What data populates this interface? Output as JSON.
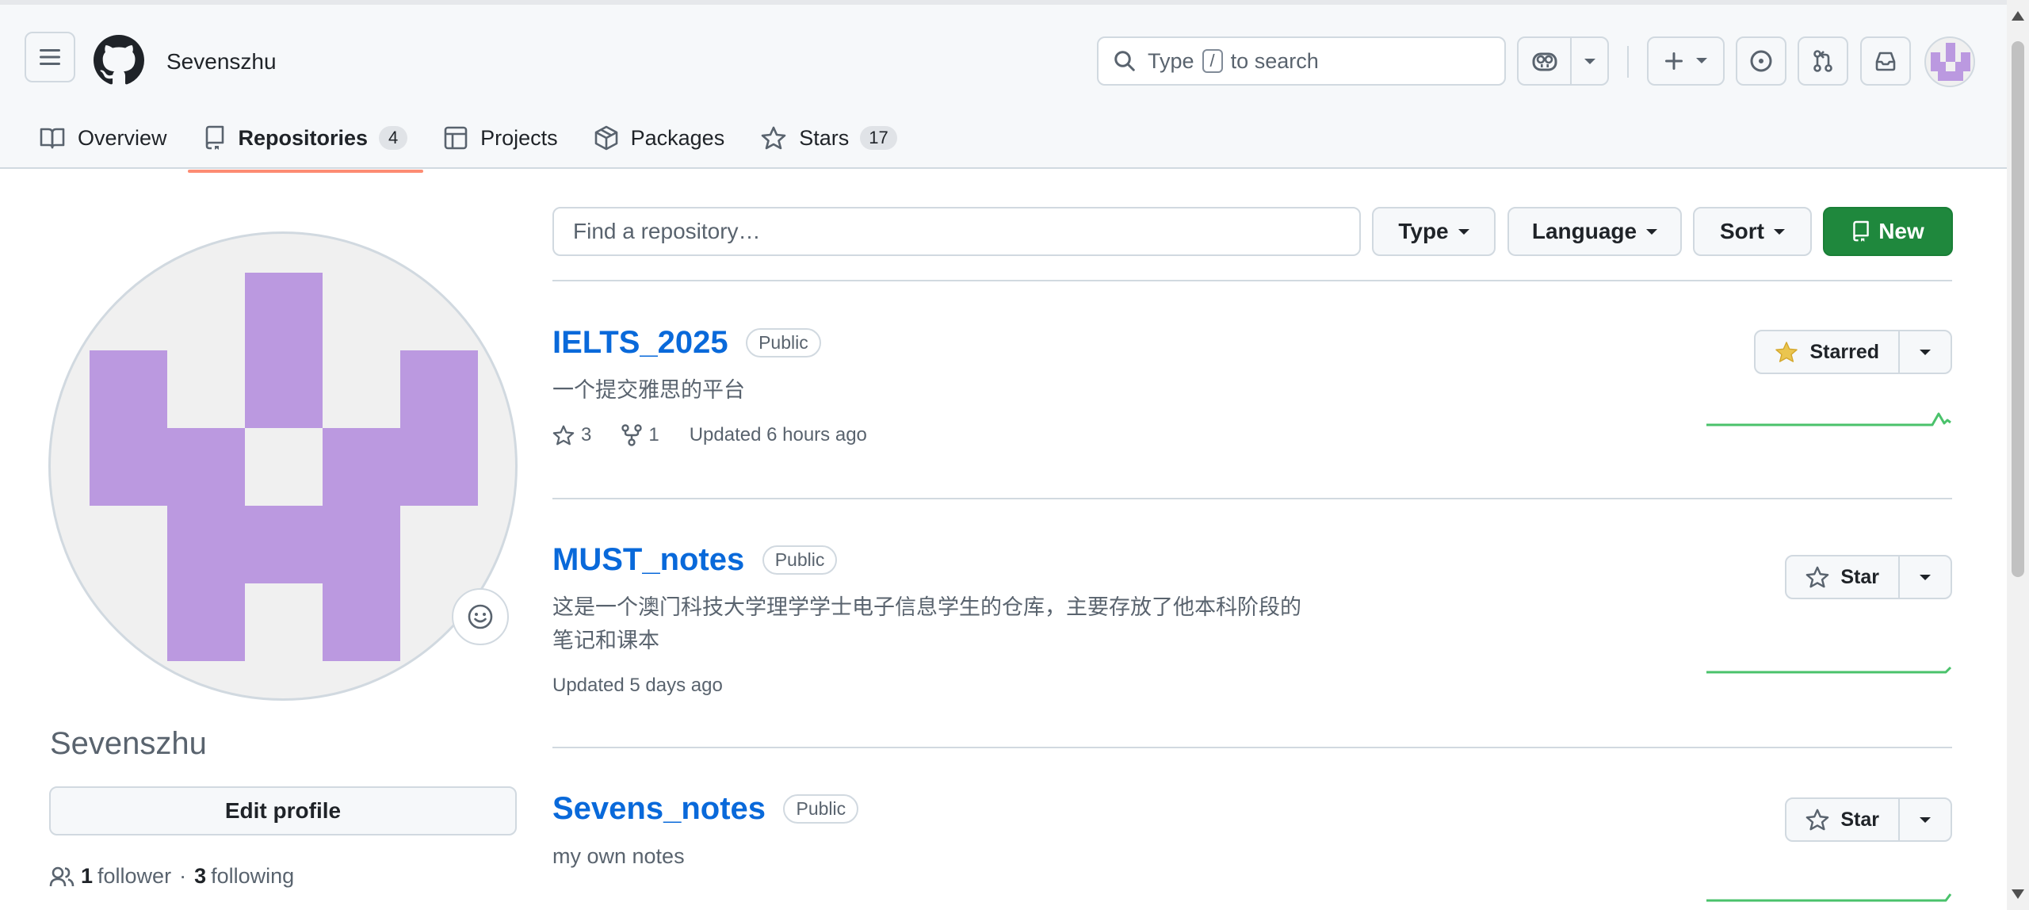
{
  "header": {
    "username": "Sevenszhu",
    "search": {
      "prefix": "Type",
      "key": "/",
      "suffix": "to search"
    }
  },
  "tabs": [
    {
      "label": "Overview",
      "icon": "book-icon"
    },
    {
      "label": "Repositories",
      "icon": "repo-icon",
      "count": "4",
      "selected": true
    },
    {
      "label": "Projects",
      "icon": "table-icon"
    },
    {
      "label": "Packages",
      "icon": "package-icon"
    },
    {
      "label": "Stars",
      "icon": "star-icon",
      "count": "17"
    }
  ],
  "profile": {
    "name": "Sevenszhu",
    "edit_label": "Edit profile",
    "followers_count": "1",
    "followers_label": "follower",
    "separator": "·",
    "following_count": "3",
    "following_label": "following"
  },
  "filters": {
    "find_placeholder": "Find a repository…",
    "type_label": "Type",
    "language_label": "Language",
    "sort_label": "Sort",
    "new_label": "New"
  },
  "repos": [
    {
      "name": "IELTS_2025",
      "visibility": "Public",
      "description": "一个提交雅思的平台",
      "stars": "3",
      "forks": "1",
      "updated": "Updated 6 hours ago",
      "star_label": "Starred",
      "starred": true
    },
    {
      "name": "MUST_notes",
      "visibility": "Public",
      "description": "这是一个澳门科技大学理学学士电子信息学生的仓库，主要存放了他本科阶段的笔记和课本",
      "updated": "Updated 5 days ago",
      "star_label": "Star",
      "starred": false
    },
    {
      "name": "Sevens_notes",
      "visibility": "Public",
      "description": "my own notes",
      "star_label": "Star",
      "starred": false
    }
  ],
  "colors": {
    "accent_link": "#0969da",
    "primary_button": "#1f883d",
    "tab_underline": "#fd8c73",
    "avatar_purple": "#bb99e0",
    "starred_yellow": "#eac54f",
    "sparkline_green": "#4ac26b"
  }
}
